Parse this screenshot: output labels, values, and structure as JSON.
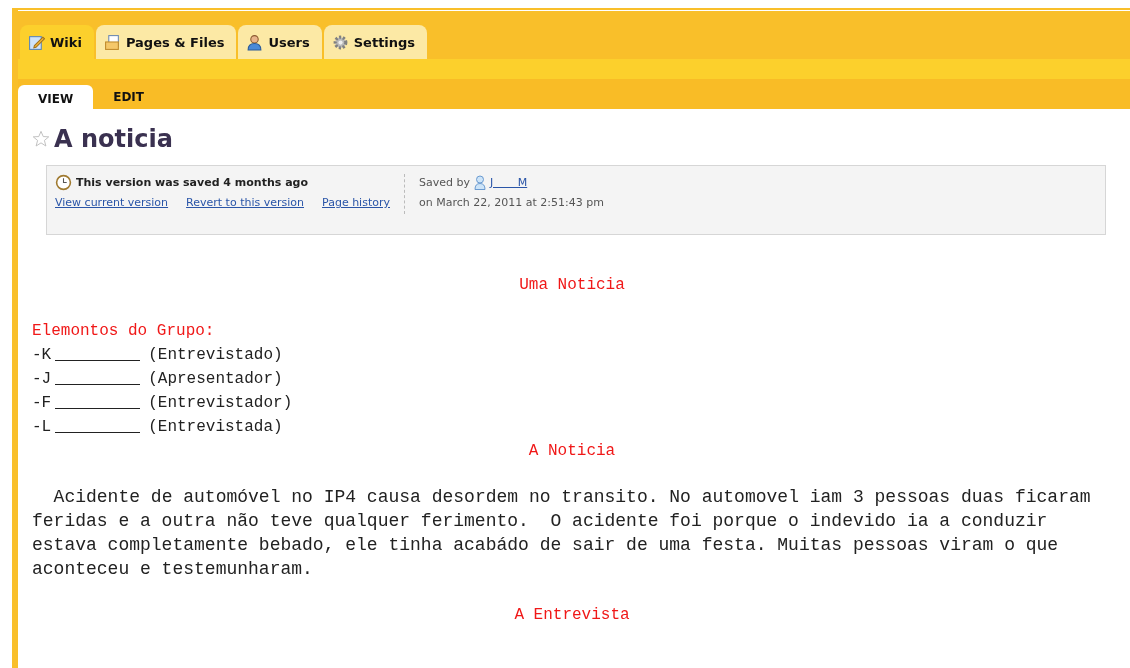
{
  "tabs": [
    {
      "label": "Wiki",
      "kind": "wiki",
      "selected": true
    },
    {
      "label": "Pages & Files",
      "kind": "pages",
      "selected": false
    },
    {
      "label": "Users",
      "kind": "users",
      "selected": false
    },
    {
      "label": "Settings",
      "kind": "settings",
      "selected": false
    }
  ],
  "subtabs": [
    {
      "label": "VIEW",
      "selected": true
    },
    {
      "label": "EDIT",
      "selected": false
    }
  ],
  "page": {
    "title": "A noticia",
    "starred": false
  },
  "version_box": {
    "notice": "This version was saved 4 months ago",
    "links": [
      "View current version",
      "Revert to this version",
      "Page history"
    ],
    "saved_by_label": "Saved by",
    "saved_by_user": "J       M",
    "saved_on": "on March 22, 2011 at 2:51:43 pm"
  },
  "content": {
    "heading": "Uma Noticia",
    "group_title": "Elemontos do Grupo:",
    "members": [
      {
        "initial": "-K",
        "role": "(Entrevistado)"
      },
      {
        "initial": "-J",
        "role": "(Apresentador)"
      },
      {
        "initial": "-F",
        "role": "(Entrevistador)"
      },
      {
        "initial": "-L",
        "role": "(Entrevistada)"
      }
    ],
    "news_heading": "A Noticia",
    "paragraph": "  Acidente de automóvel no IP4 causa desordem no transito. No automovel iam 3 pessoas duas ficaram feridas e a outra não teve qualquer ferimento.  O acidente foi porque o indevido ia a conduzir estava completamente bebado, ele tinha acabádo de sair de uma festa. Muitas pessoas viram o que aconteceu e testemunharam.",
    "interview_heading": "A Entrevista"
  }
}
